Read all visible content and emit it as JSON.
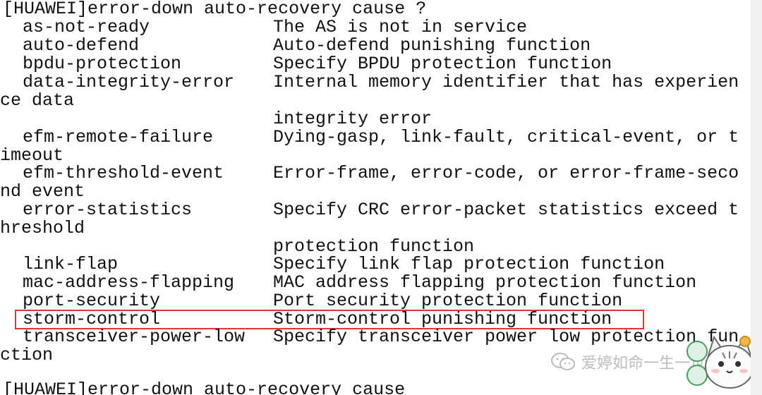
{
  "prompt_line_1": "[HUAWEI]error-down auto-recovery cause ?",
  "rows": [
    {
      "cmd": "as-not-ready",
      "desc": "The AS is not in service"
    },
    {
      "cmd": "auto-defend",
      "desc": "Auto-defend punishing function"
    },
    {
      "cmd": "bpdu-protection",
      "desc": "Specify BPDU protection function"
    },
    {
      "cmd": "data-integrity-error",
      "desc": "Internal memory identifier that has experien",
      "wrap": "ce data",
      "cont": "integrity error"
    },
    {
      "cmd": "efm-remote-failure",
      "desc": "Dying-gasp, link-fault, critical-event, or t",
      "wrap": "imeout"
    },
    {
      "cmd": "efm-threshold-event",
      "desc": "Error-frame, error-code, or error-frame-seco",
      "wrap": "nd event"
    },
    {
      "cmd": "error-statistics",
      "desc": "Specify CRC error-packet statistics exceed t",
      "wrap": "hreshold",
      "cont": "protection function"
    },
    {
      "cmd": "link-flap",
      "desc": "Specify link flap protection function"
    },
    {
      "cmd": "mac-address-flapping",
      "desc": "MAC address flapping protection function"
    },
    {
      "cmd": "port-security",
      "desc": "Port security protection function"
    },
    {
      "cmd": "storm-control",
      "desc": "Storm-control punishing function",
      "highlighted": true
    },
    {
      "cmd": "transceiver-power-low",
      "desc": "Specify transceiver power low protection fun",
      "wrap": "ction"
    }
  ],
  "prompt_line_2": "[HUAWEI]error-down auto-recovery cause",
  "watermark": {
    "text": "爱婷如命一生一世",
    "icon": "wechat-icon"
  },
  "colors": {
    "text": "#111111",
    "highlight": "#e0353b",
    "background": "#ffffff"
  }
}
